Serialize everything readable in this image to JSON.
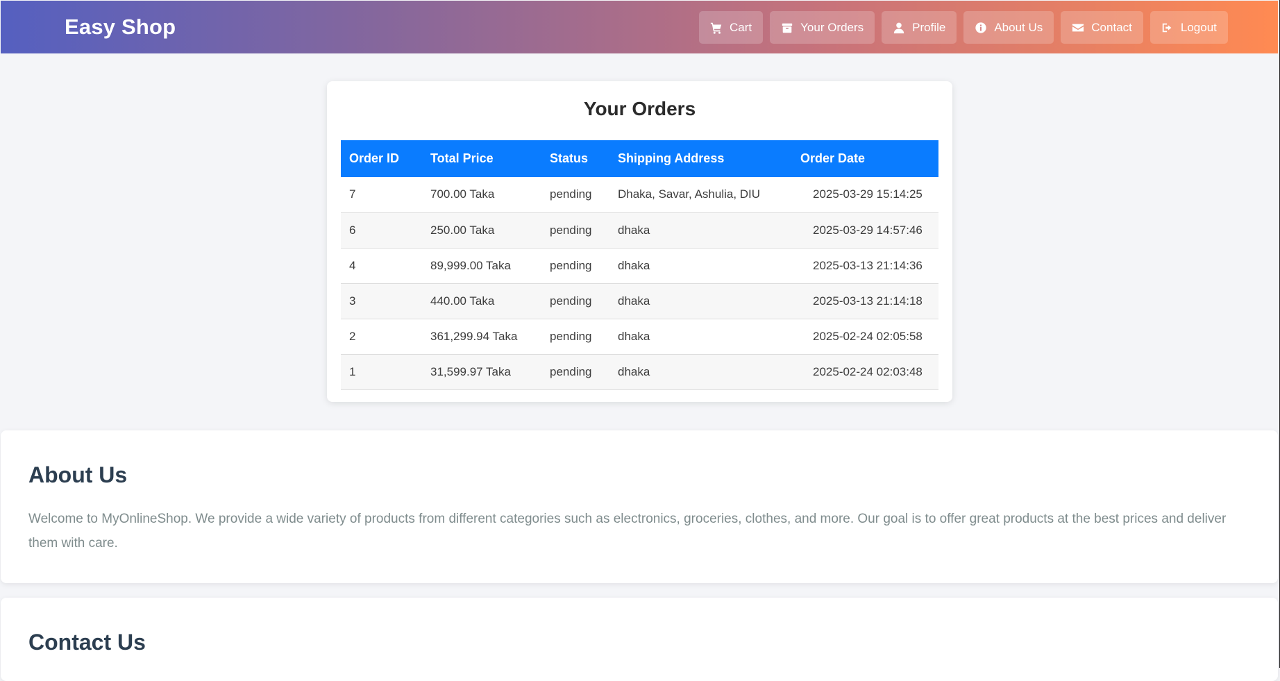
{
  "navbar": {
    "brand": "Easy Shop",
    "links": [
      {
        "label": "Cart",
        "icon": "cart-icon"
      },
      {
        "label": "Your Orders",
        "icon": "box-icon"
      },
      {
        "label": "Profile",
        "icon": "user-icon"
      },
      {
        "label": "About Us",
        "icon": "info-icon"
      },
      {
        "label": "Contact",
        "icon": "envelope-icon"
      },
      {
        "label": "Logout",
        "icon": "logout-icon"
      }
    ]
  },
  "orders": {
    "title": "Your Orders",
    "columns": [
      "Order ID",
      "Total Price",
      "Status",
      "Shipping Address",
      "Order Date"
    ],
    "rows": [
      [
        "7",
        "700.00 Taka",
        "pending",
        "Dhaka, Savar, Ashulia, DIU",
        "2025-03-29 15:14:25"
      ],
      [
        "6",
        "250.00 Taka",
        "pending",
        "dhaka",
        "2025-03-29 14:57:46"
      ],
      [
        "4",
        "89,999.00 Taka",
        "pending",
        "dhaka",
        "2025-03-13 21:14:36"
      ],
      [
        "3",
        "440.00 Taka",
        "pending",
        "dhaka",
        "2025-03-13 21:14:18"
      ],
      [
        "2",
        "361,299.94 Taka",
        "pending",
        "dhaka",
        "2025-02-24 02:05:58"
      ],
      [
        "1",
        "31,599.97 Taka",
        "pending",
        "dhaka",
        "2025-02-24 02:03:48"
      ]
    ]
  },
  "about": {
    "title": "About Us",
    "text": "Welcome to MyOnlineShop. We provide a wide variety of products from different categories such as electronics, groceries, clothes, and more. Our goal is to offer great products at the best prices and deliver them with care."
  },
  "contact": {
    "title": "Contact Us"
  },
  "colors": {
    "header_start": "#5560c0",
    "header_end": "#ff8a52",
    "table_header": "#0a7cff",
    "heading": "#2c3e50",
    "body_text": "#7f8c8d"
  }
}
